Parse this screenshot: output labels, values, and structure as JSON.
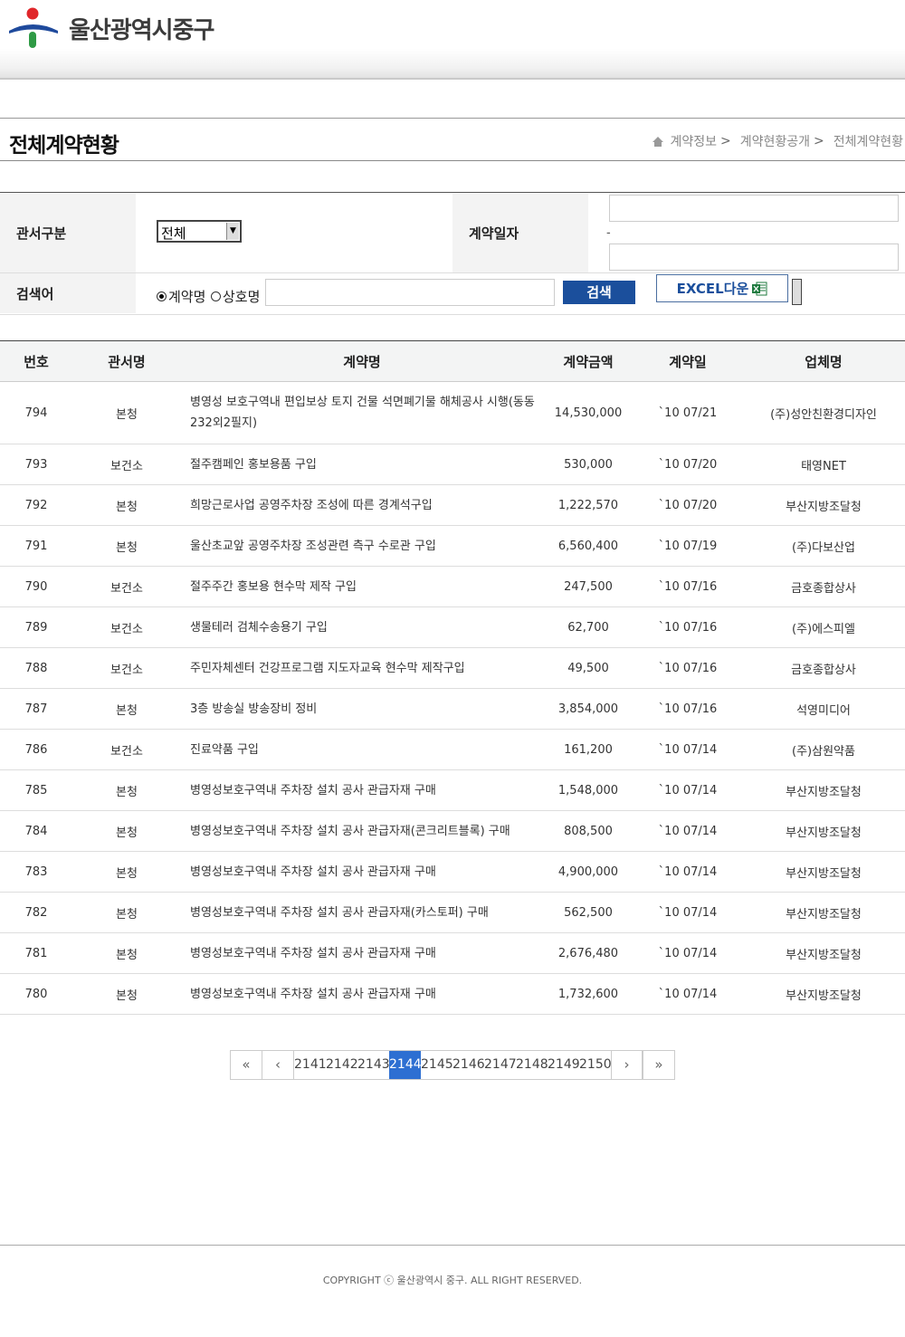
{
  "header": {
    "org_name": "울산광역시중구"
  },
  "title_bar": {
    "page_title": "전체계약현황",
    "breadcrumb": [
      "계약정보",
      "계약현황공개",
      "전체계약현황"
    ]
  },
  "search": {
    "dept_label": "관서구분",
    "dept_selected": "전체",
    "date_label": "계약일자",
    "date_separator": "-",
    "date_from": "",
    "date_to": "",
    "keyword_label": "검색어",
    "radio_contract": "계약명",
    "radio_company": "상호명",
    "keyword_value": "",
    "search_button": "검색",
    "excel_button": "EXCEL다운"
  },
  "table": {
    "headers": [
      "번호",
      "관서명",
      "계약명",
      "계약금액",
      "계약일",
      "업체명"
    ],
    "rows": [
      {
        "no": "794",
        "dept": "본청",
        "name": "병영성 보호구역내 편입보상 토지 건물 석면폐기물 해체공사 시행(동동 232외2필지)",
        "amount": "14,530,000",
        "date": "`10 07/21",
        "company": "(주)성안친환경디자인"
      },
      {
        "no": "793",
        "dept": "보건소",
        "name": "절주캠페인 홍보용품 구입",
        "amount": "530,000",
        "date": "`10 07/20",
        "company": "태영NET"
      },
      {
        "no": "792",
        "dept": "본청",
        "name": "희망근로사업 공영주차장 조성에 따른 경계석구입",
        "amount": "1,222,570",
        "date": "`10 07/20",
        "company": "부산지방조달청"
      },
      {
        "no": "791",
        "dept": "본청",
        "name": "울산초교앞 공영주차장 조성관련 측구 수로관 구입",
        "amount": "6,560,400",
        "date": "`10 07/19",
        "company": "(주)다보산업"
      },
      {
        "no": "790",
        "dept": "보건소",
        "name": "절주주간 홍보용 현수막 제작 구입",
        "amount": "247,500",
        "date": "`10 07/16",
        "company": "금호종합상사"
      },
      {
        "no": "789",
        "dept": "보건소",
        "name": "생물테러 검체수송용기 구입",
        "amount": "62,700",
        "date": "`10 07/16",
        "company": "(주)에스피엘"
      },
      {
        "no": "788",
        "dept": "보건소",
        "name": "주민자체센터 건강프로그램 지도자교육 현수막 제작구입",
        "amount": "49,500",
        "date": "`10 07/16",
        "company": "금호종합상사"
      },
      {
        "no": "787",
        "dept": "본청",
        "name": "3층 방송실 방송장비 정비",
        "amount": "3,854,000",
        "date": "`10 07/16",
        "company": "석영미디어"
      },
      {
        "no": "786",
        "dept": "보건소",
        "name": "진료약품 구입",
        "amount": "161,200",
        "date": "`10 07/14",
        "company": "(주)삼원약품"
      },
      {
        "no": "785",
        "dept": "본청",
        "name": "병영성보호구역내 주차장 설치 공사 관급자재 구매",
        "amount": "1,548,000",
        "date": "`10 07/14",
        "company": "부산지방조달청"
      },
      {
        "no": "784",
        "dept": "본청",
        "name": "병영성보호구역내 주차장 설치 공사 관급자재(콘크리트블록) 구매",
        "amount": "808,500",
        "date": "`10 07/14",
        "company": "부산지방조달청"
      },
      {
        "no": "783",
        "dept": "본청",
        "name": "병영성보호구역내 주차장 설치 공사 관급자재 구매",
        "amount": "4,900,000",
        "date": "`10 07/14",
        "company": "부산지방조달청"
      },
      {
        "no": "782",
        "dept": "본청",
        "name": "병영성보호구역내 주차장 설치 공사 관급자재(카스토퍼) 구매",
        "amount": "562,500",
        "date": "`10 07/14",
        "company": "부산지방조달청"
      },
      {
        "no": "781",
        "dept": "본청",
        "name": "병영성보호구역내 주차장 설치 공사 관급자재 구매",
        "amount": "2,676,480",
        "date": "`10 07/14",
        "company": "부산지방조달청"
      },
      {
        "no": "780",
        "dept": "본청",
        "name": "병영성보호구역내 주차장 설치 공사 관급자재 구매",
        "amount": "1,732,600",
        "date": "`10 07/14",
        "company": "부산지방조달청"
      }
    ]
  },
  "paging": {
    "first": "«",
    "prev": "‹",
    "next": "›",
    "last": "»",
    "pages": [
      "2141",
      "2142",
      "2143",
      "2144",
      "2145",
      "2146",
      "2147",
      "2148",
      "2149",
      "2150"
    ],
    "current": "2144"
  },
  "footer": {
    "copyright": "COPYRIGHT ⓒ 울산광역시 중구. ALL RIGHT RESERVED."
  },
  "colors": {
    "accent": "#1b4f9c",
    "current_page": "#2d6fd2",
    "logo_red": "#e0262a",
    "logo_blue": "#1f4a9c",
    "logo_green": "#2f9a45"
  },
  "icons": {
    "home": "home-icon",
    "excel": "excel-icon",
    "select_arrow": "chevron-down-icon"
  }
}
